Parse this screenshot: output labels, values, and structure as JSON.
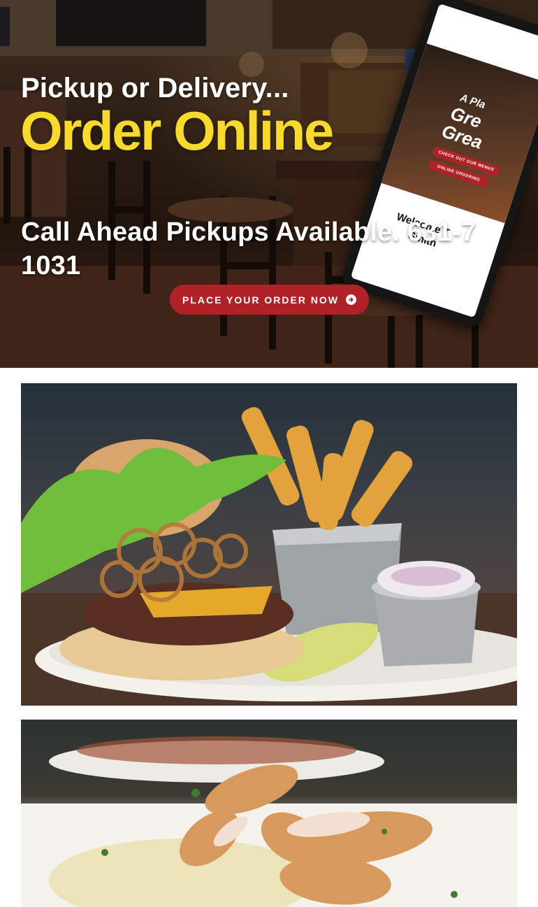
{
  "hero": {
    "eyebrow": "Pickup or Delivery...",
    "headline": "Order Online",
    "call_ahead": "Call Ahead Pickups Available. 631-7",
    "call_ahead_line2": "1031",
    "cta_label": "PLACE YOUR ORDER NOW",
    "cta_icon": "arrow-circle-right-icon",
    "colors": {
      "headline": "#f7da2b",
      "cta_bg": "#b02128",
      "text": "#ffffff"
    }
  },
  "tablet": {
    "tagline": "A Pla",
    "title_line1": "Gre",
    "title_line2": "Grea",
    "pill1": "CHECK OUT OUR MENUS",
    "pill2": "ONLINE ORDERING",
    "welcome_line1": "Welcome T",
    "welcome_line2": "Smith"
  },
  "photos": [
    {
      "name": "burger-photo",
      "subject": "burger with fries, pickle and coleslaw"
    },
    {
      "name": "chicken-photo",
      "subject": "sliced chicken entree"
    }
  ]
}
